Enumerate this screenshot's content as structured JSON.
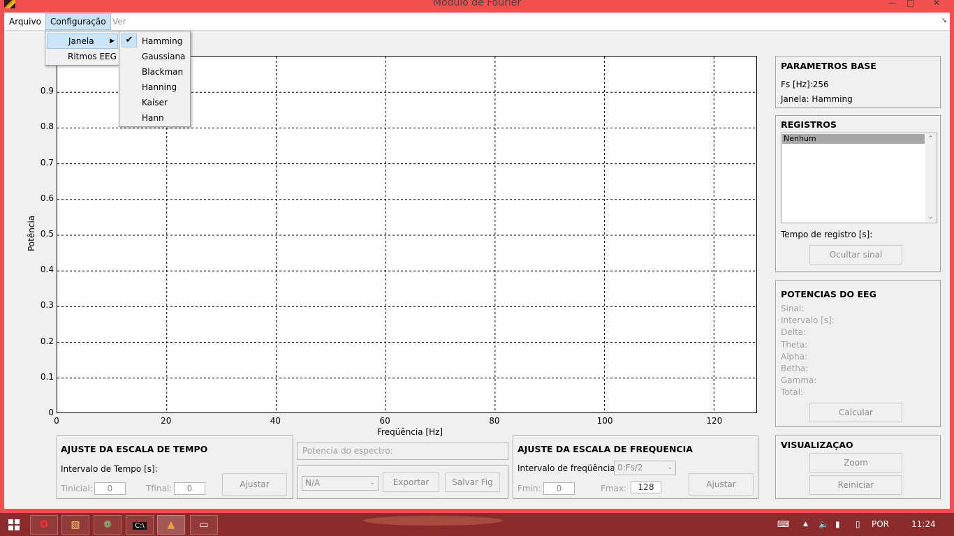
{
  "window": {
    "title": "Modulo de Fourier"
  },
  "menubar": {
    "arquivo": "Arquivo",
    "configuracao": "Configuração",
    "ver": "Ver"
  },
  "config_menu": {
    "janela": "Janela",
    "ritmos": "Ritmos EEG"
  },
  "janela_submenu": {
    "items": [
      "Hamming",
      "Gaussiana",
      "Blackman",
      "Hanning",
      "Kaiser",
      "Hann"
    ],
    "checked": "Hamming"
  },
  "chart_data": {
    "type": "line",
    "xlabel": "Freqüência [Hz]",
    "ylabel": "Potência",
    "xlim": [
      0,
      128
    ],
    "ylim": [
      0,
      1
    ],
    "xticks": [
      0,
      20,
      40,
      60,
      80,
      100,
      120
    ],
    "yticks": [
      0,
      0.1,
      0.2,
      0.3,
      0.4,
      0.5,
      0.6,
      0.7,
      0.8,
      0.9
    ],
    "ytick_labels": [
      "0",
      "0.1",
      "0.2",
      "0.3",
      "0.4",
      "0.5",
      "0.6",
      "0.7",
      "0.8",
      "0.9"
    ],
    "grid": true,
    "series": []
  },
  "parametros": {
    "title": "PARAMETROS BASE",
    "fs": "Fs [Hz]:256",
    "janela": "Janela: Hamming"
  },
  "registros": {
    "title": "REGISTROS",
    "list_item": "Nenhum",
    "tempo_label": "Tempo de registro [s]:",
    "ocultar_button": "Ocultar sinal"
  },
  "potencias": {
    "title": "POTENCIAS DO EEG",
    "labels": [
      "Sinal:",
      "Intervalo [s]:",
      "Delta:",
      "Theta:",
      "Alpha:",
      "Betha:",
      "Gamma:",
      "Total:"
    ],
    "calcular_button": "Calcular"
  },
  "visualizacao": {
    "title": "VISUALIZAÇAO",
    "zoom_button": "Zoom",
    "reiniciar_button": "Reiniciar"
  },
  "tempo": {
    "title": "AJUSTE DA ESCALA DE TEMPO",
    "intervalo_label": "Intervalo de Tempo [s]:",
    "tinicial_label": "Tinicial:",
    "tinicial_value": "0",
    "tfinal_label": "Tfinal:",
    "tfinal_value": "0",
    "ajustar_button": "Ajustar"
  },
  "espectro": {
    "potencia_placeholder": "Potencia do espectro:",
    "select_value": "N/A",
    "exportar_button": "Exportar",
    "salvar_button": "Salvar Fig"
  },
  "frequencia": {
    "title": "AJUSTE DA ESCALA DE FREQUENCIA",
    "intervalo_label": "Intervalo de freqüência:",
    "select_value": "0:Fs/2",
    "fmin_label": "Fmin:",
    "fmin_value": "0",
    "fmax_label": "Fmax:",
    "fmax_value": "128",
    "ajustar_button": "Ajustar"
  },
  "taskbar": {
    "lang": "POR",
    "time": "11:24"
  },
  "colors": {
    "frame": "#f25050",
    "taskbar": "#8a2a2a",
    "menu_highlight": "#cce4f7"
  }
}
